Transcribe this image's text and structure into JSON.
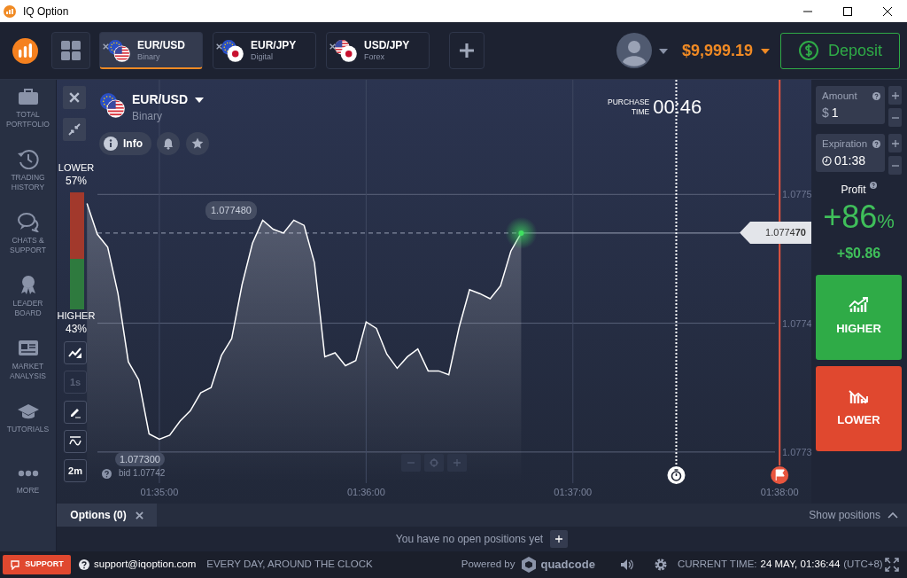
{
  "window": {
    "title": "IQ Option"
  },
  "header": {
    "asset_tabs": [
      {
        "pair": "EUR/USD",
        "type": "Binary",
        "selected": true
      },
      {
        "pair": "EUR/JPY",
        "type": "Digital",
        "selected": false
      },
      {
        "pair": "USD/JPY",
        "type": "Forex",
        "selected": false
      }
    ],
    "balance": "$9,999.19",
    "deposit_button": "Deposit"
  },
  "sidebar": {
    "items": [
      {
        "kind": "portfolio",
        "label": "TOTAL\nPORTFOLIO"
      },
      {
        "kind": "history",
        "label": "TRADING\nHISTORY"
      },
      {
        "kind": "chat",
        "label": "CHATS &\nSUPPORT"
      },
      {
        "kind": "leaderboard",
        "label": "LEADER\nBOARD"
      },
      {
        "kind": "analysis",
        "label": "MARKET\nANALYSIS"
      },
      {
        "kind": "tutorials",
        "label": "TUTORIALS"
      },
      {
        "kind": "more",
        "label": "MORE"
      }
    ]
  },
  "chart": {
    "asset": {
      "pair": "EUR/USD",
      "type": "Binary"
    },
    "info_button": "Info",
    "sentiment": {
      "lower_label": "LOWER",
      "lower_percent": "57%",
      "higher_label": "HIGHER",
      "higher_percent": "43%",
      "level": 0.57
    },
    "tools": [
      {
        "kind": "chart-type",
        "disabled": false
      },
      {
        "kind": "label",
        "label": "1s",
        "disabled": true
      },
      {
        "kind": "draw",
        "disabled": false
      },
      {
        "kind": "indicators",
        "disabled": false
      },
      {
        "kind": "label",
        "label": "2m",
        "disabled": false
      }
    ],
    "purchase_time": {
      "label": "PURCHASE\nTIME",
      "value": "00:46"
    },
    "price_bubble": "1.077480",
    "current_price": "1.0774**70**",
    "quote": {
      "value": "1.077300",
      "bid": "bid 1.07742"
    },
    "chart_data": {
      "type": "area",
      "grid": true,
      "ref_lines": [
        {
          "axis": "y",
          "value": 1.07747
        }
      ],
      "categories": [
        null,
        null,
        null,
        null,
        null,
        null,
        null,
        null,
        "01:35:00",
        null,
        null,
        null,
        null,
        null,
        null,
        null,
        null,
        null,
        null,
        null,
        null,
        null,
        null,
        null,
        null,
        null,
        null,
        null,
        "01:36:00",
        null,
        null,
        null,
        null,
        null,
        null,
        null,
        null,
        null,
        null,
        null,
        null,
        null,
        null,
        null,
        null,
        null,
        null,
        null,
        "01:37:00",
        null,
        null,
        null,
        null,
        null,
        null,
        null,
        null,
        null,
        null,
        null,
        null,
        null,
        null,
        null,
        null,
        null,
        null,
        null,
        "01:38:00"
      ],
      "values": [
        null,
        1.077493,
        1.077469,
        1.077459,
        1.077423,
        1.07737,
        1.077356,
        1.077314,
        1.07731,
        1.077313,
        1.077324,
        1.077332,
        1.077346,
        1.07735,
        1.077375,
        1.077388,
        1.07743,
        1.077462,
        1.07748,
        1.077473,
        1.07747,
        1.07748,
        1.077476,
        1.077447,
        1.077374,
        1.077377,
        1.077367,
        1.077371,
        1.077401,
        1.077396,
        1.077376,
        1.077365,
        1.077374,
        1.07738,
        1.077363,
        1.077363,
        1.07736,
        1.077397,
        1.077426,
        1.077423,
        1.077419,
        1.077429,
        1.077456,
        1.07747,
        null,
        null,
        null,
        null,
        null,
        null,
        null,
        null,
        null,
        null,
        null,
        null,
        null,
        null,
        null,
        null,
        null,
        null,
        null,
        null,
        null,
        null,
        null,
        null,
        null
      ],
      "ylim": [
        1.07726,
        1.077589
      ],
      "yticks": [
        {
          "value": 1.0773,
          "label": "1.0773"
        },
        {
          "value": 1.0774,
          "label": "1.0774"
        },
        {
          "value": 1.0775,
          "label": "1.0775"
        }
      ]
    }
  },
  "trade_panel": {
    "amount": {
      "label": "Amount",
      "currency": "$",
      "value": "1"
    },
    "expiration": {
      "label": "Expiration",
      "value": "01:38"
    },
    "profit": {
      "label": "Profit",
      "percent": "+86",
      "percent_sign": "%",
      "amount": "+$0.86"
    },
    "buttons": [
      {
        "kind": "higher",
        "label": "HIGHER"
      },
      {
        "kind": "lower",
        "label": "LOWER"
      }
    ]
  },
  "positions": {
    "tab": "Options (0)",
    "show_positions": "Show positions",
    "empty_message": "You have no open positions yet"
  },
  "status_bar": {
    "support_button": "SUPPORT",
    "email": "support@iqoption.com",
    "hours": "EVERY DAY, AROUND THE CLOCK",
    "powered_by": "Powered by",
    "brand": "quadcode",
    "time_label": "CURRENT TIME:",
    "time": "24 MAY, 01:36:44",
    "timezone": "(UTC+8)"
  }
}
